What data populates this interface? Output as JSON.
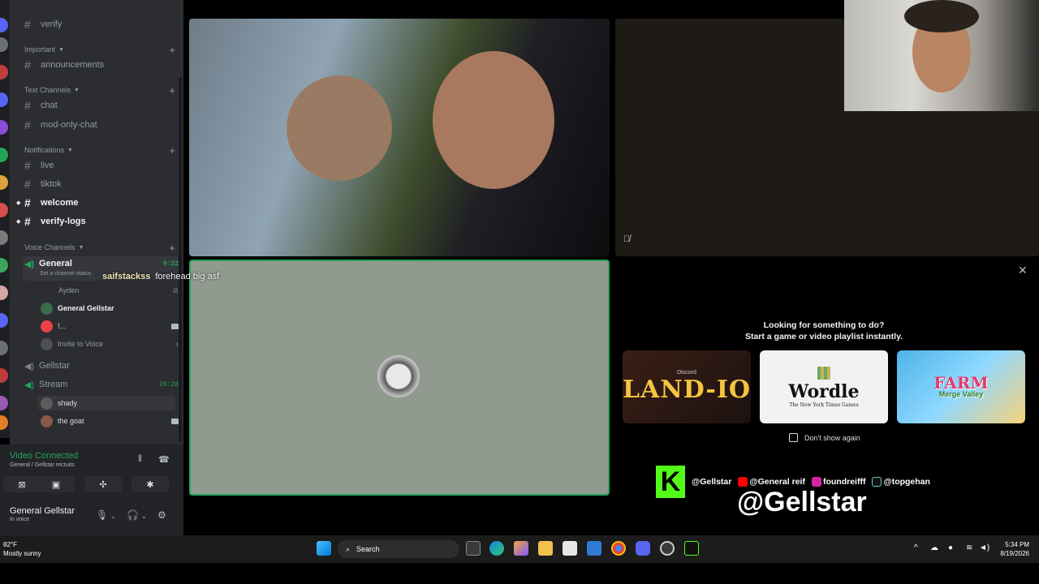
{
  "sidebar": {
    "top_channel": "verify",
    "categories": {
      "important": "Important",
      "text": "Text Channels",
      "notifications": "Notifications",
      "voice": "Voice Channels"
    },
    "important_channels": [
      "announcements"
    ],
    "text_channels": [
      "chat",
      "mod-only-chat"
    ],
    "notification_channels": [
      "live",
      "tiktok",
      "welcome",
      "verify-logs"
    ],
    "voice": {
      "general_name": "General",
      "general_timer": "9:22",
      "general_status": "Set a channel status",
      "members": [
        "Ayden",
        "General Gellstar",
        "!..."
      ],
      "invite": "Invite to Voice",
      "gellstar": "Gellstar",
      "stream_name": "Stream",
      "stream_timer": "29:28",
      "stream_members": [
        "shady",
        "the goat"
      ]
    }
  },
  "connection": {
    "title": "Video Connected",
    "subtitle": "General / Gellstar recruits"
  },
  "user": {
    "name": "General Gellstar",
    "status": "In voice"
  },
  "overlay_chat": {
    "user": "saifstackss",
    "message": "forehead big asf"
  },
  "activity": {
    "line1": "Looking for something to do?",
    "line2": "Start a game or video playlist instantly.",
    "cards": [
      {
        "title": "LAND-IO",
        "sub": "Discord"
      },
      {
        "title": "Wordle",
        "sub": "The New York Times Games"
      },
      {
        "title": "FARM",
        "sub": "Merge Valley"
      }
    ],
    "dont_show": "Don't show again"
  },
  "streamer": {
    "handle_big": "@Gellstar",
    "socials": [
      "@Gellstar",
      "@General reif",
      "foundreifff",
      "@topgehan"
    ]
  },
  "taskbar": {
    "weather_temp": "82°F",
    "weather_desc": "Mostly sunny",
    "search": "Search",
    "time": "5:34 PM",
    "date": "8/19/2026"
  },
  "colors": {
    "accent_green": "#23a559",
    "sidebar_bg": "#2b2d31",
    "kick_green": "#53fc18"
  }
}
